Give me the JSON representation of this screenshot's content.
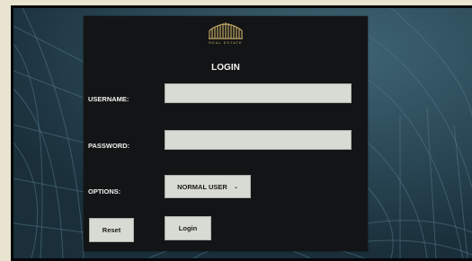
{
  "logo": {
    "icon": "building-skyline-icon",
    "name": "REAL ESTATE",
    "color": "#c0a765"
  },
  "login": {
    "title": "LOGIN",
    "username_label": "USERNAME:",
    "username_value": "",
    "password_label": "PASSWORD:",
    "password_value": "",
    "options_label": "OPTIONS:",
    "options_selected": "NORMAL USER",
    "reset_label": "Reset",
    "login_label": "Login"
  },
  "colors": {
    "panel": "#131415",
    "background": "#24404e",
    "field": "#d8dbd3"
  }
}
